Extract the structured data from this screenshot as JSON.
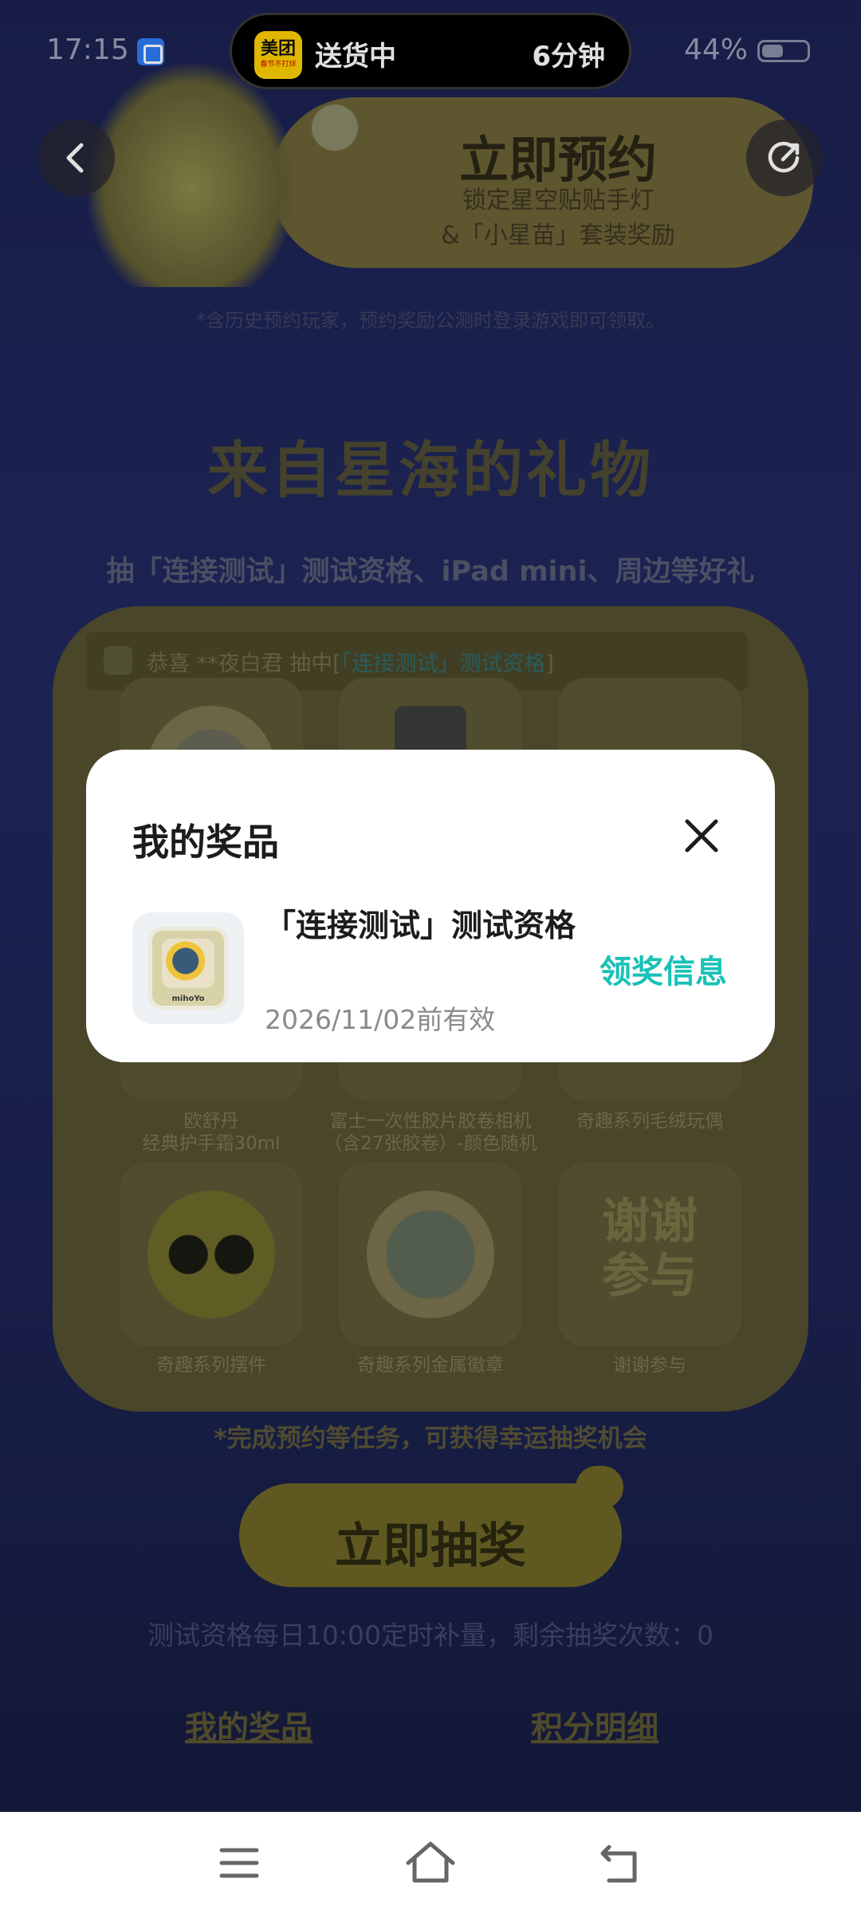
{
  "status_bar": {
    "time": "17:15",
    "battery": "44%",
    "battery_level": 0.44,
    "live_activity": {
      "app": "美团",
      "app_tagline": "春节不打烊",
      "label": "送货中",
      "eta": "6分钟"
    }
  },
  "banner": {
    "title": "立即预约",
    "subtitle_line1": "锁定星空贴贴手灯",
    "subtitle_line2": "&「小星苗」套装奖励",
    "note": "*含历史预约玩家，预约奖励公测时登录游戏即可领取。"
  },
  "gifts": {
    "title": "来自星海的礼物",
    "subtitle": "抽「连接测试」测试资格、iPad mini、周边等好礼",
    "ticker_prefix": "恭喜 **夜白君 抽中[",
    "ticker_highlight": "「连接测试」测试资格",
    "ticker_suffix": "]",
    "prizes": [
      {
        "label": "欧舒丹\n经典护手霜30ml"
      },
      {
        "label": "富士一次性胶片胶卷相机\n（含27张胶卷）-颜色随机"
      },
      {
        "label": "奇趣系列毛绒玩偶"
      },
      {
        "label": "奇趣系列摆件"
      },
      {
        "label": "奇趣系列金属徽章"
      },
      {
        "label": "谢谢参与",
        "tile_text": "谢谢\n参与"
      }
    ],
    "task_hint": "*完成预约等任务，可获得幸运抽奖机会",
    "draw_button": "立即抽奖",
    "refill_note": "测试资格每日10:00定时补量，剩余抽奖次数：0",
    "link_my_prizes": "我的奖品",
    "link_points": "积分明细"
  },
  "modal": {
    "title": "我的奖品",
    "items": [
      {
        "name": "「连接测试」测试资格",
        "expiry": "2026/11/02前有效",
        "action": "领奖信息",
        "thumb_brand": "mihoYo"
      }
    ]
  },
  "colors": {
    "accent": "#18c2b6",
    "background": "#1b2250",
    "modal_bg": "#ffffff"
  }
}
